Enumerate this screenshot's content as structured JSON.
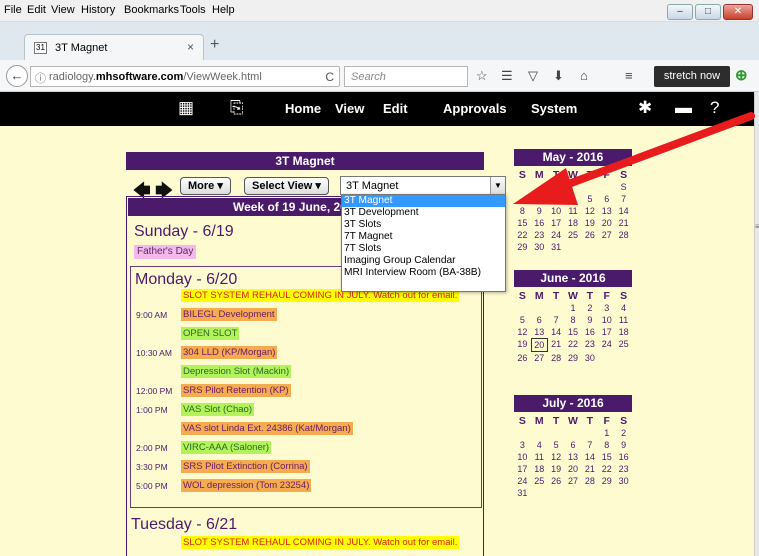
{
  "menu": [
    "File",
    "Edit",
    "View",
    "History",
    "Bookmarks",
    "Tools",
    "Help"
  ],
  "tab": {
    "title": "3T Magnet",
    "close": "×",
    "newtab": "+",
    "favicon": "31"
  },
  "nav": {
    "url_prefix": "radiology.",
    "url_domain": "mhsoftware.com",
    "url_path": "/ViewWeek.html",
    "search_placeholder": "Search",
    "stretch_label": "stretch now"
  },
  "appnav": [
    "Home",
    "View",
    "Edit",
    "Approvals",
    "System"
  ],
  "calendar_title": "3T Magnet",
  "buttons": {
    "more": "More ▾",
    "select_view": "Select View ▾"
  },
  "view_select": {
    "value": "3T Magnet",
    "options": [
      "3T Magnet",
      "3T Development",
      "3T Slots",
      "7T Magnet",
      "7T Slots",
      "Imaging Group Calendar",
      "MRI Interview Room (BA-38B)"
    ]
  },
  "week_header": "Week of 19 June, 2016",
  "sunday": {
    "title": "Sunday - 6/19",
    "holiday": "Father's Day"
  },
  "monday": {
    "title": "Monday - 6/20",
    "events": [
      {
        "time": "",
        "text": "SLOT SYSTEM REHAUL COMING IN JULY. Watch out for email.",
        "style": "y"
      },
      {
        "time": "9:00 AM",
        "text": "BILEGL Development",
        "style": "o"
      },
      {
        "time": "",
        "text": "OPEN SLOT",
        "style": "g"
      },
      {
        "time": "10:30 AM",
        "text": "304 LLD (KP/Morgan)",
        "style": "o"
      },
      {
        "time": "",
        "text": "Depression Slot (Mackin)",
        "style": "g"
      },
      {
        "time": "12:00 PM",
        "text": "SRS Pilot Retention (KP)",
        "style": "o"
      },
      {
        "time": "1:00 PM",
        "text": "VAS Slot (Chao)",
        "style": "g"
      },
      {
        "time": "",
        "text": "VAS slot Linda Ext. 24386 (Kat/Morgan)",
        "style": "o"
      },
      {
        "time": "2:00 PM",
        "text": "VIRC-AAA (Saloner)",
        "style": "g"
      },
      {
        "time": "3:30 PM",
        "text": "SRS Pilot Extinction (Corrina)",
        "style": "o"
      },
      {
        "time": "5:00 PM",
        "text": "WOL depression (Tom 23254)",
        "style": "o"
      }
    ]
  },
  "tuesday": {
    "title": "Tuesday - 6/21",
    "events": [
      {
        "text": "SLOT SYSTEM REHAUL COMING IN JULY. Watch out for email.",
        "style": "y"
      }
    ]
  },
  "mini_cals": [
    {
      "title": "May - 2016",
      "days": [
        "S",
        "M",
        "T",
        "W",
        "T",
        "F",
        "S"
      ],
      "cells": [
        "",
        "",
        "",
        "",
        "",
        "",
        "S",
        "",
        "",
        "",
        "4",
        "5",
        "6",
        "7",
        "8",
        "9",
        "10",
        "11",
        "12",
        "13",
        "14",
        "15",
        "16",
        "17",
        "18",
        "19",
        "20",
        "21",
        "22",
        "23",
        "24",
        "25",
        "26",
        "27",
        "28",
        "29",
        "30",
        "31"
      ],
      "today": ""
    },
    {
      "title": "June - 2016",
      "days": [
        "S",
        "M",
        "T",
        "W",
        "T",
        "F",
        "S"
      ],
      "cells": [
        "",
        "",
        "",
        "1",
        "2",
        "3",
        "4",
        "5",
        "6",
        "7",
        "8",
        "9",
        "10",
        "11",
        "12",
        "13",
        "14",
        "15",
        "16",
        "17",
        "18",
        "19",
        "20",
        "21",
        "22",
        "23",
        "24",
        "25",
        "26",
        "27",
        "28",
        "29",
        "30"
      ],
      "today": "20"
    },
    {
      "title": "July - 2016",
      "days": [
        "S",
        "M",
        "T",
        "W",
        "T",
        "F",
        "S"
      ],
      "cells": [
        "",
        "",
        "",
        "",
        "",
        "1",
        "2",
        "3",
        "4",
        "5",
        "6",
        "7",
        "8",
        "9",
        "10",
        "11",
        "12",
        "13",
        "14",
        "15",
        "16",
        "17",
        "18",
        "19",
        "20",
        "21",
        "22",
        "23",
        "24",
        "25",
        "26",
        "27",
        "28",
        "29",
        "30",
        "31"
      ],
      "today": ""
    }
  ],
  "colors": {
    "purple": "#4a1a6b",
    "content_bg": "#fffbd0",
    "annotation_arrow": "#e81c1c",
    "selected": "#3399ff"
  }
}
